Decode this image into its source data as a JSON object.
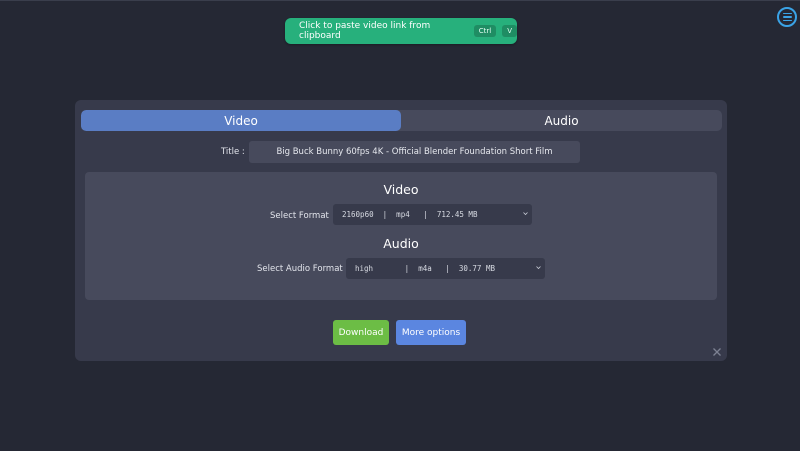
{
  "menu": {
    "icon": "menu-icon",
    "accent": "#3aa3e6"
  },
  "paste_banner": {
    "text": "Click to paste video link from clipboard",
    "key_ctrl": "Ctrl",
    "key_v": "V",
    "color": "#27b07c"
  },
  "tabs": [
    {
      "label": "Video",
      "active": true
    },
    {
      "label": "Audio",
      "active": false
    }
  ],
  "title": {
    "label": "Title :",
    "value": "Big Buck Bunny 60fps 4K - Official Blender Foundation Short Film"
  },
  "video": {
    "heading": "Video",
    "select_label": "Select Format",
    "selected": "2160p60  |  mp4   |  712.45 MB"
  },
  "audio": {
    "heading": "Audio",
    "select_label": "Select Audio Format",
    "selected": "high       |  m4a   |  30.77 MB"
  },
  "buttons": {
    "download": "Download",
    "more_options": "More options"
  },
  "close_icon": "close-icon",
  "colors": {
    "background": "#252834",
    "card": "#373a4b",
    "active_tab": "#5a7dc4",
    "download": "#6cbd45",
    "more_options": "#5b86e0"
  }
}
